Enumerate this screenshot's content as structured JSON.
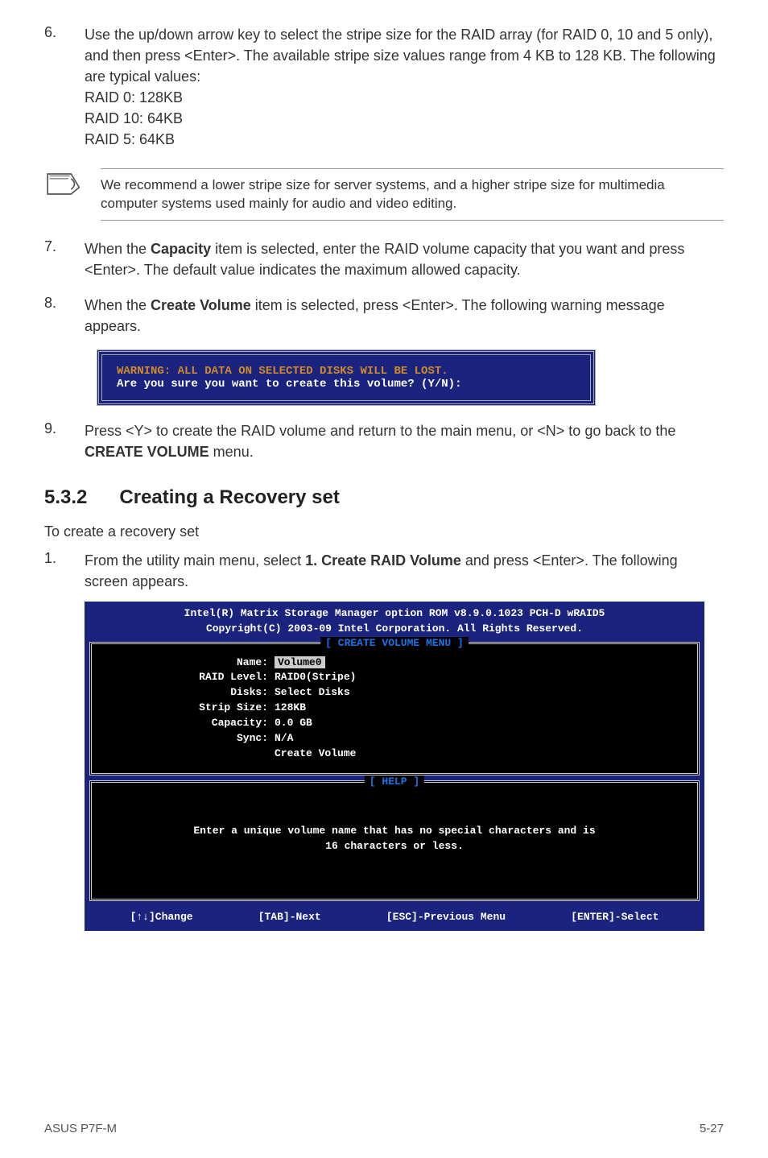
{
  "step6": {
    "num": "6.",
    "text": "Use the up/down arrow key to select the stripe size for the RAID array (for RAID 0, 10 and 5 only), and then press <Enter>. The available stripe size values range from 4 KB to 128 KB. The following are typical values:",
    "l1": "RAID 0: 128KB",
    "l2": "RAID 10: 64KB",
    "l3": "RAID 5: 64KB"
  },
  "note": "We recommend a lower stripe size for server systems, and a higher stripe size for multimedia computer systems used mainly for audio and video editing.",
  "step7": {
    "num": "7.",
    "pre": "When the ",
    "b": "Capacity",
    "post": " item is selected, enter the RAID volume capacity that you want and press <Enter>. The default value indicates the maximum allowed capacity."
  },
  "step8": {
    "num": "8.",
    "pre": "When the ",
    "b": "Create Volume",
    "post": " item is selected, press <Enter>. The following warning message appears."
  },
  "warnbox": {
    "l1": "WARNING: ALL DATA ON SELECTED DISKS WILL BE LOST.",
    "l2": "Are you sure you want to create this volume? (Y/N):"
  },
  "step9": {
    "num": "9.",
    "pre": "Press <Y> to create the RAID volume and return to the main menu, or <N> to go back to the ",
    "b": "CREATE VOLUME",
    "post": " menu."
  },
  "section": {
    "num": "5.3.2",
    "title": "Creating a Recovery set"
  },
  "intro": "To create a recovery set",
  "step1": {
    "num": "1.",
    "pre": "From the utility main menu, select ",
    "b": "1. Create RAID Volume",
    "post": " and press <Enter>. The following screen appears."
  },
  "bios": {
    "h1": "Intel(R) Matrix Storage Manager option ROM v8.9.0.1023 PCH-D wRAID5",
    "h2": "Copyright(C) 2003-09 Intel Corporation.  All Rights Reserved.",
    "panel1_title": "[ CREATE VOLUME MENU ]",
    "labels": {
      "name": "Name:",
      "raid": "RAID Level:",
      "disks": "Disks:",
      "strip": "Strip Size:",
      "cap": "Capacity:",
      "sync": "Sync:"
    },
    "vals": {
      "name": "Volume0",
      "raid": "RAID0(Stripe)",
      "disks": "Select Disks",
      "strip": "128KB",
      "cap": "0.0   GB",
      "sync": "N/A",
      "create": "Create Volume"
    },
    "panel2_title": "[ HELP ]",
    "help1": "Enter a unique volume name that has no special characters and is",
    "help2": "16 characters or less.",
    "k1": "[↑↓]Change",
    "k2": "[TAB]-Next",
    "k3": "[ESC]-Previous Menu",
    "k4": "[ENTER]-Select"
  },
  "footer": {
    "left": "ASUS P7F-M",
    "right": "5-27"
  }
}
